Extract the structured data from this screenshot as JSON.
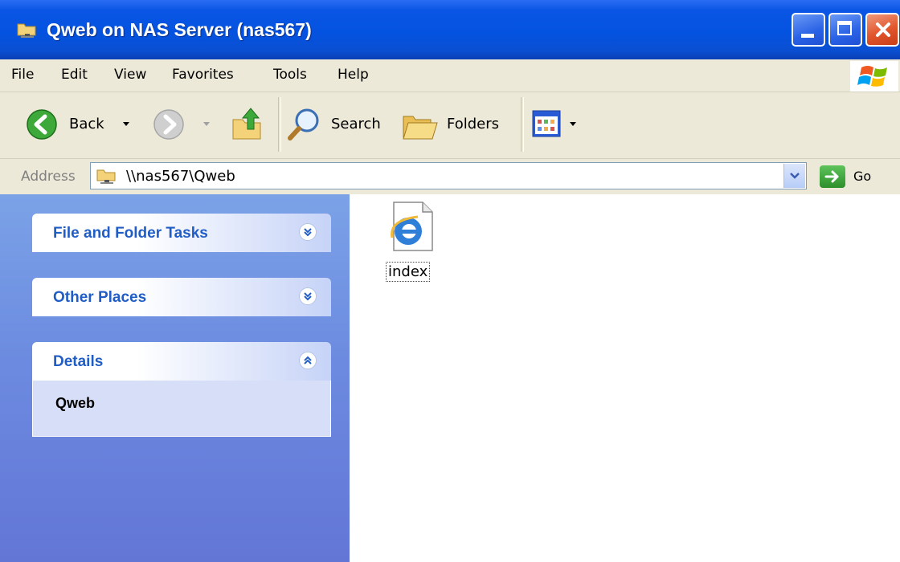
{
  "window": {
    "title": "Qweb on NAS Server (nas567)"
  },
  "menu": [
    "File",
    "Edit",
    "View",
    "Favorites",
    "Tools",
    "Help"
  ],
  "toolbar": {
    "back_label": "Back",
    "search_label": "Search",
    "folders_label": "Folders"
  },
  "address": {
    "label": "Address",
    "value": "\\\\nas567\\Qweb",
    "go_label": "Go"
  },
  "taskpane": {
    "panels": [
      {
        "title": "File and Folder Tasks",
        "state": "collapsed"
      },
      {
        "title": "Other Places",
        "state": "collapsed"
      },
      {
        "title": "Details",
        "state": "expanded",
        "body": "Qweb"
      }
    ]
  },
  "content": {
    "items": [
      {
        "name": "index",
        "icon": "internet-explorer-file-icon"
      }
    ]
  },
  "colors": {
    "titlebar": "#0453e0",
    "taskpane": "#6c8be0",
    "panel_title": "#215dc6",
    "chrome": "#ece9d8"
  }
}
